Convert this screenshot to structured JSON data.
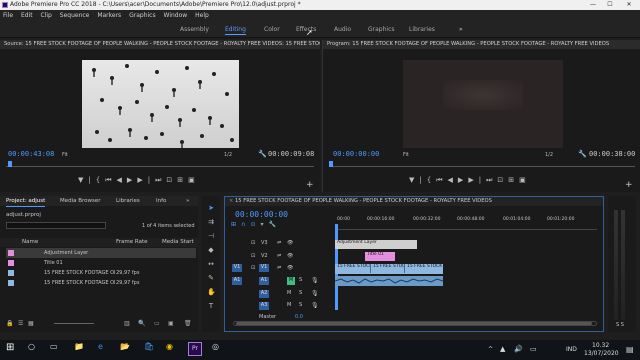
{
  "window": {
    "title": "Adobe Premiere Pro CC 2018 - C:\\Users\\acer\\Documents\\Adobe\\Premiere Pro\\12.0\\adjust.prproj *",
    "min": "—",
    "max": "☐",
    "close": "✕"
  },
  "menu": [
    "File",
    "Edit",
    "Clip",
    "Sequence",
    "Markers",
    "Graphics",
    "Window",
    "Help"
  ],
  "workspaces": {
    "items": [
      "Assembly",
      "Editing",
      "Color",
      "Effects",
      "Audio",
      "Graphics",
      "Libraries"
    ],
    "active": "Editing",
    "more": "»"
  },
  "source": {
    "title": "Source: 15 FREE STOCK FOOTAGE OF PEOPLE WALKING - PEOPLE STOCK FOOTAGE - ROYALTY FREE VIDEOS: 15 FREE STOCK F",
    "timecode": "00:00:43:08",
    "fit": "Fit",
    "resolution": "1/2",
    "duration": "00:00:09:08"
  },
  "program": {
    "title": "Program: 15 FREE STOCK FOOTAGE OF PEOPLE WALKING - PEOPLE STOCK FOOTAGE - ROYALTY FREE VIDEOS",
    "timecode": "00:00:00:00",
    "fit": "Fit",
    "resolution": "1/2",
    "duration": "00:00:38:00"
  },
  "project": {
    "tabs": [
      "Project: adjust",
      "Media Browser",
      "Libraries",
      "Info"
    ],
    "file": "adjust.prproj",
    "items_selected": "1 of 4 items selected",
    "columns": [
      "Name",
      "Frame Rate",
      "Media Start"
    ],
    "items": [
      {
        "name": "Adjustment Layer",
        "fps": "",
        "color": "#e58ee0",
        "selected": true
      },
      {
        "name": "Title 01",
        "fps": "",
        "color": "#e58ee0",
        "selected": false
      },
      {
        "name": "15 FREE STOCK FOOTAGE OI",
        "fps": "29,97 fps",
        "color": "#8fb8e0",
        "selected": false
      },
      {
        "name": "15 FREE STOCK FOOTAGE OI",
        "fps": "29,97 fps",
        "color": "#8fb8e0",
        "selected": false
      }
    ]
  },
  "timeline": {
    "tab": "15 FREE STOCK FOOTAGE OF PEOPLE WALKING - PEOPLE STOCK FOOTAGE - ROYALTY FREE VIDEOS",
    "timecode": "00:00:00:00",
    "ruler": [
      "00:00",
      "00:00:16:00",
      "00:00:32:00",
      "00:00:48:00",
      "00:01:04:00",
      "00:01:20:00"
    ],
    "tracks": [
      "V3",
      "V2",
      "V1",
      "A1",
      "A2",
      "A3"
    ],
    "source_v": "V1",
    "source_a": "A1",
    "master": "Master",
    "master_val": "0.0",
    "clips": {
      "adjustment": "Adjustment Layer",
      "title": "Title 01",
      "video1": "15 FREE STOCK",
      "video2": "15 FREE STOCK F",
      "video3": "15 FREE STOCK FOOTAG"
    }
  },
  "taskbar": {
    "search": "Ask me anything",
    "lang": "IND",
    "time": "10.32",
    "date": "13/07/2020",
    "apps": [
      "explorer",
      "edge",
      "folder",
      "store",
      "chrome",
      "firefox",
      "premiere",
      "word",
      "media"
    ]
  },
  "colors": {
    "accent": "#4d9bff",
    "adjustment": "#e58ee0",
    "video": "#8fb8e0",
    "title_clip": "#e58ee0"
  }
}
